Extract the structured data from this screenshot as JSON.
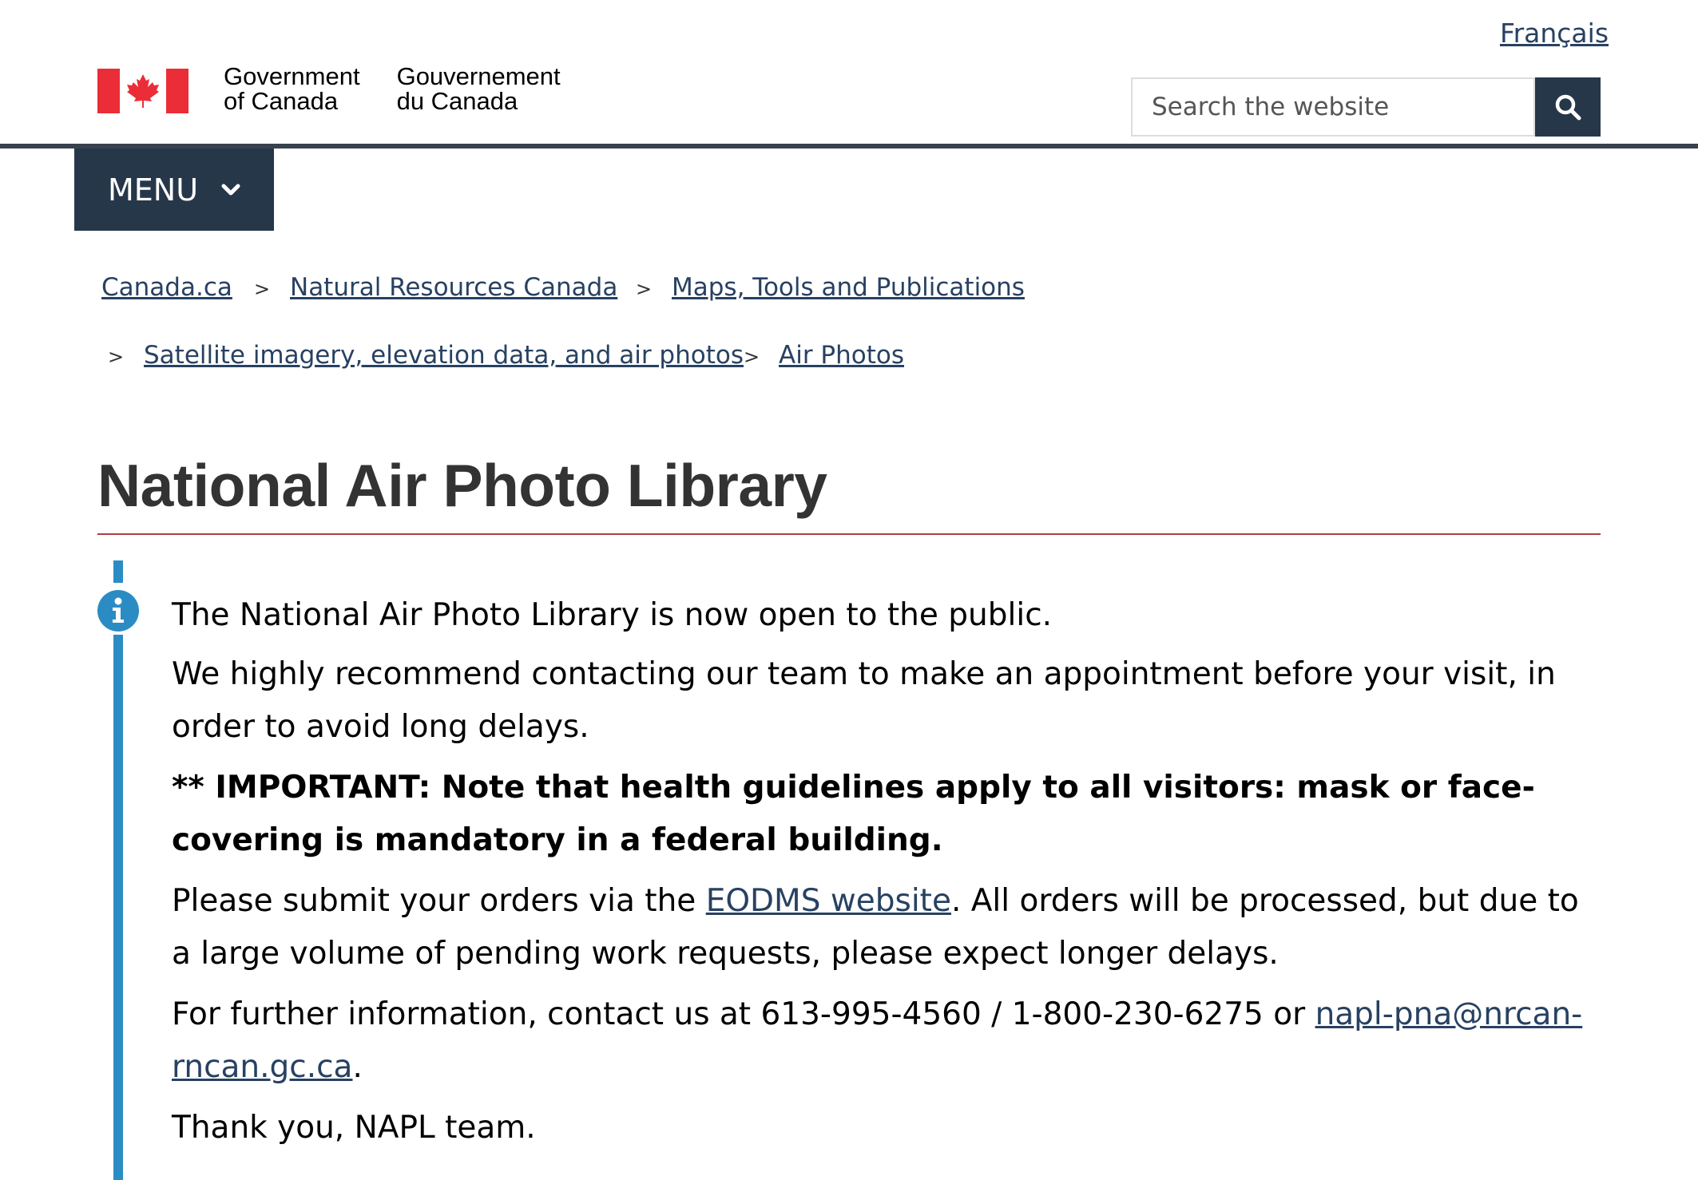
{
  "header": {
    "language_link": "Français",
    "wordmark_en_line1": "Government",
    "wordmark_en_line2": "of Canada",
    "wordmark_fr_line1": "Gouvernement",
    "wordmark_fr_line2": "du Canada",
    "search_placeholder": "Search the website",
    "search_icon": "search-icon",
    "menu_label": "MENU",
    "menu_icon": "chevron-down-icon"
  },
  "breadcrumb": {
    "separator": ">",
    "items": [
      {
        "label": "Canada.ca"
      },
      {
        "label": "Natural Resources Canada"
      },
      {
        "label": "Maps, Tools and Publications"
      },
      {
        "label": "Satellite imagery, elevation data, and air photos"
      },
      {
        "label": "Air Photos"
      }
    ]
  },
  "page": {
    "title": "National Air Photo Library"
  },
  "alert": {
    "icon": "info-icon",
    "line1": "The National Air Photo Library is now open to the public.",
    "line2": "We highly recommend contacting our team to make an appointment before your visit, in order to avoid long delays.",
    "important": "** IMPORTANT: Note that health guidelines apply to all visitors: mask or face-covering is mandatory in a federal building.",
    "orders_before": "Please submit your orders via the ",
    "orders_link": "EODMS website",
    "orders_after": ". All orders will be processed, but due to a large volume of pending work requests, please expect longer delays.",
    "contact_before": "For further information, contact us at 613-995-4560 / 1-800-230-6275 or ",
    "contact_email": "napl-pna@nrcan-rncan.gc.ca",
    "contact_after": ".",
    "closing": "Thank you, NAPL team."
  },
  "colors": {
    "brand_red": "#eb2d37",
    "dark_blue": "#26374a",
    "link_blue": "#284162",
    "title_rule": "#af3c43",
    "alert_info": "#2b8cc4"
  }
}
